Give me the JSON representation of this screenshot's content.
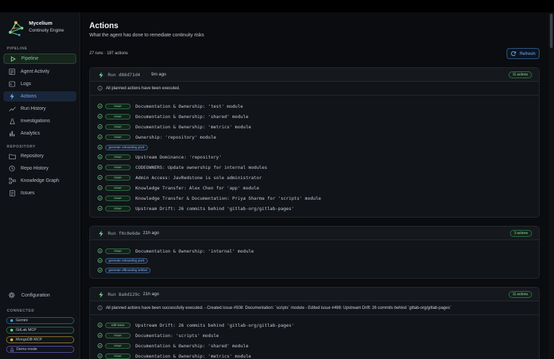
{
  "brand": {
    "name": "Mycelium",
    "subtitle": "Continuity Engine"
  },
  "sidebar": {
    "pipeline_label": "PIPELINE",
    "repository_label": "REPOSITORY",
    "connected_label": "CONNECTED",
    "items": [
      {
        "label": "Pipeline",
        "icon": "play-icon",
        "state": "active-green"
      },
      {
        "label": "Agent Activity",
        "icon": "activity-list-icon"
      },
      {
        "label": "Logs",
        "icon": "terminal-icon"
      },
      {
        "label": "Actions",
        "icon": "bolt-icon",
        "state": "active-blue"
      },
      {
        "label": "Run History",
        "icon": "trend-icon"
      },
      {
        "label": "Investigations",
        "icon": "flask-icon"
      },
      {
        "label": "Analytics",
        "icon": "bar-chart-icon"
      }
    ],
    "repo_items": [
      {
        "label": "Repository",
        "icon": "folder-icon"
      },
      {
        "label": "Repo History",
        "icon": "history-icon"
      },
      {
        "label": "Knowledge Graph",
        "icon": "graph-icon"
      },
      {
        "label": "Issues",
        "icon": "issue-doc-icon"
      }
    ],
    "configuration": "Configuration",
    "connections": [
      {
        "label": "Gemini",
        "color": "#3fa2f0",
        "border": "#2b5a86"
      },
      {
        "label": "GitLab MCP",
        "color": "#6fd48e",
        "border": "#2f6b43"
      },
      {
        "label": "MongoDB MCP",
        "color": "#e2b84a",
        "border": "#8a7330"
      },
      {
        "label": "Demo mode",
        "color": "#a88ef0",
        "border": "#5a4a9a"
      }
    ]
  },
  "main": {
    "title": "Actions",
    "subtitle": "What the agent has done to remediate continuity risks",
    "counts": "27 runs · 197 actions",
    "refresh_label": "Refresh"
  },
  "runs": [
    {
      "run_label": "Run d86d71d4",
      "time": "9m ago",
      "badge": "11 actions",
      "summary": "All planned actions have been executed.",
      "actions": [
        {
          "tag": "issue",
          "tag_label": "issue",
          "text": "Documentation & Ownership: 'test' module"
        },
        {
          "tag": "issue",
          "tag_label": "issue",
          "text": "Documentation & Ownership: 'shared' module"
        },
        {
          "tag": "issue",
          "tag_label": "issue",
          "text": "Documentation & Ownership: 'metrics' module"
        },
        {
          "tag": "issue",
          "tag_label": "issue",
          "text": "Ownership: 'repository' module"
        },
        {
          "tag": "gen",
          "tag_label": "generate onboarding pack",
          "text": ""
        },
        {
          "tag": "issue",
          "tag_label": "issue",
          "text": "Upstream Dominance: 'repository'"
        },
        {
          "tag": "issue",
          "tag_label": "issue",
          "text": "CODEOWNERS: Update ownership for internal modules"
        },
        {
          "tag": "issue",
          "tag_label": "issue",
          "text": "Admin Access: JavRedstone is sole administrator"
        },
        {
          "tag": "issue",
          "tag_label": "issue",
          "text": "Knowledge Transfer: Alex Chen for 'app' module"
        },
        {
          "tag": "issue",
          "tag_label": "issue",
          "text": "Knowledge Transfer & Documentation: Priya Sharma for 'scripts' module"
        },
        {
          "tag": "issue",
          "tag_label": "issue",
          "text": "Upstream Drift: 26 commits behind 'gitlab-org/gitlab-pages'"
        }
      ]
    },
    {
      "run_label": "Run f0c0e6de",
      "time": "21h ago",
      "badge": "3 actions",
      "summary": "",
      "actions": [
        {
          "tag": "issue",
          "tag_label": "issue",
          "text": "Documentation & Ownership: 'internal' module"
        },
        {
          "tag": "gen",
          "tag_label": "generate onboarding pack",
          "text": ""
        },
        {
          "tag": "gen",
          "tag_label": "generate offboarding artifact",
          "text": ""
        }
      ]
    },
    {
      "run_label": "Run 8a6d129c",
      "time": "21h ago",
      "badge": "11 actions",
      "summary": "All planned actions have been successfully executed. - Created issue #508: Documentation: `scripts` module - Edited issue #498: Upstream Drift: 26 commits behind `gitlab-org/gitlab-pages`",
      "actions": [
        {
          "tag": "edit",
          "tag_label": "edit issue",
          "text": "Upstream Drift: 26 commits behind 'gitlab-org/gitlab-pages'"
        },
        {
          "tag": "issue",
          "tag_label": "issue",
          "text": "Documentation: 'scripts' module"
        },
        {
          "tag": "issue",
          "tag_label": "issue",
          "text": "Documentation & Ownership: 'shared' module"
        },
        {
          "tag": "issue",
          "tag_label": "issue",
          "text": "Documentation & Ownership: 'metrics' module"
        }
      ]
    }
  ]
}
